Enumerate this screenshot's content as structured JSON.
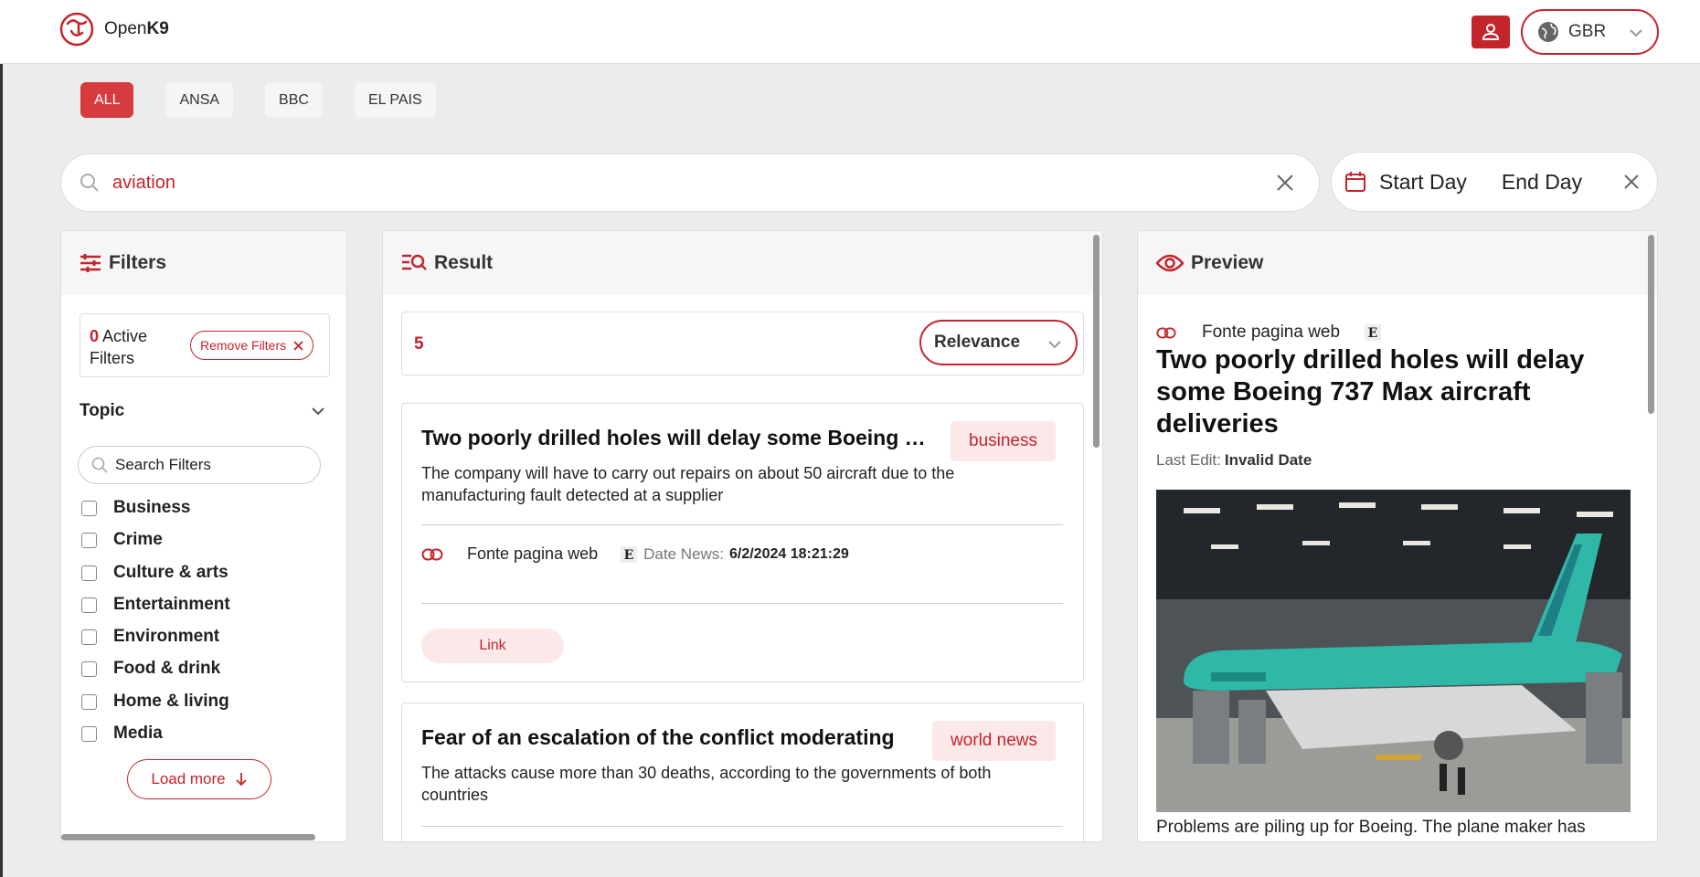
{
  "app": {
    "logo_prefix": "Open",
    "logo_suffix": "K9",
    "language": "GBR"
  },
  "source_tabs": [
    {
      "label": "ALL",
      "active": true
    },
    {
      "label": "ANSA",
      "active": false
    },
    {
      "label": "BBC",
      "active": false
    },
    {
      "label": "EL PAIS",
      "active": false
    }
  ],
  "search": {
    "value": "aviation"
  },
  "date_range": {
    "start": "Start Day",
    "end": "End Day"
  },
  "filters": {
    "title": "Filters",
    "active_count": "0",
    "active_label": "Active Filters",
    "remove_label": "Remove Filters",
    "topic_title": "Topic",
    "search_placeholder": "Search Filters",
    "topics": [
      "Business",
      "Crime",
      "Culture & arts",
      "Entertainment",
      "Environment",
      "Food & drink",
      "Home & living",
      "Media"
    ],
    "load_more": "Load more"
  },
  "result": {
    "title": "Result",
    "count": "5",
    "sort": "Relevance",
    "cards": [
      {
        "title": "Two poorly drilled holes will delay some Boeing 737 Max aircraft deliveries",
        "tag": "business",
        "description": "The company will have to carry out repairs on about 50 aircraft due to the manufacturing fault detected at a supplier",
        "source": "Fonte pagina web",
        "date_label": "Date News:",
        "date": "6/2/2024 18:21:29",
        "link": "Link"
      },
      {
        "title": "Fear of an escalation of the conflict moderating",
        "tag": "world news",
        "description": "The attacks cause more than 30 deaths, according to the governments of both countries"
      }
    ]
  },
  "preview": {
    "title_label": "Preview",
    "source": "Fonte pagina web",
    "title": "Two poorly drilled holes will delay some Boeing 737 Max aircraft deliveries",
    "last_edit_label": "Last Edit:",
    "last_edit": "Invalid Date",
    "description": "Problems are piling up for Boeing. The plane maker has"
  },
  "colors": {
    "accent": "#c4242c",
    "tag_bg": "#fbe9ea",
    "background": "#ececec"
  }
}
